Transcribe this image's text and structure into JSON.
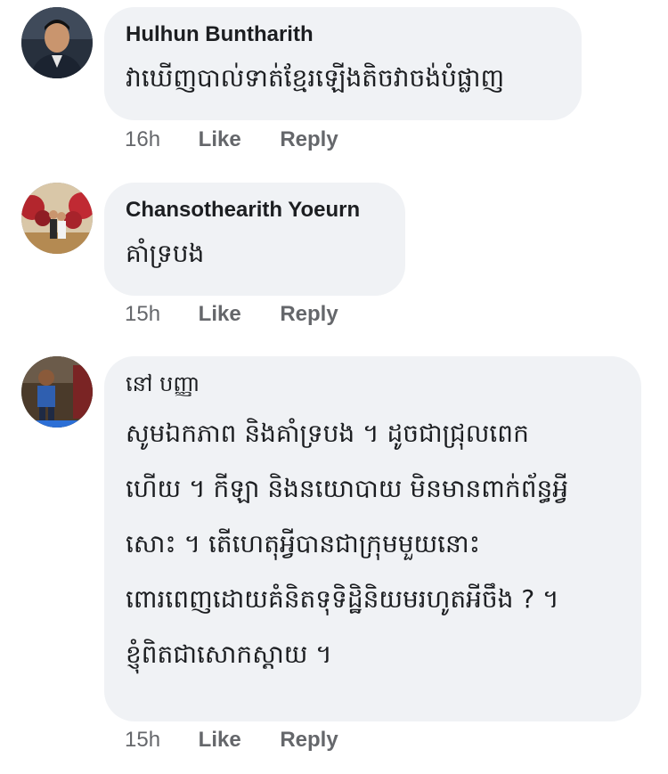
{
  "comments": [
    {
      "author": "Hulhun Buntharith",
      "text": "វាឃើញបាល់ទាត់ខ្មែរឡើងតិចវាចង់បំផ្លាញ",
      "time": "16h",
      "like_label": "Like",
      "reply_label": "Reply"
    },
    {
      "author": "Chansothearith Yoeurn",
      "text": "គាំទ្របង",
      "time": "15h",
      "like_label": "Like",
      "reply_label": "Reply"
    },
    {
      "author": "នៅ បញ្ញា",
      "lines": [
        "សូមឯកភាព និងគាំទ្របង ។ ដូចជាជ្រុលពេក",
        "ហើយ ។ កីឡា និងនយោបាយ មិនមានពាក់ព័ន្ធអ្វី",
        "សោះ ។ តើហេតុអ្វីបានជាក្រុមមួយនោះ",
        "ពោរពេញដោយគំនិតទុទិដ្ឋិនិយមរហូតអីចឹង ? ។",
        "ខ្ញុំពិតជាសោកស្ដាយ ។"
      ],
      "time": "15h",
      "like_label": "Like",
      "reply_label": "Reply"
    }
  ],
  "icons": {
    "avatar_1": "avatar-photo-man",
    "avatar_2": "avatar-photo-couple-flowers",
    "avatar_3": "avatar-photo-child"
  },
  "colors": {
    "bubble": "#f0f2f5",
    "text": "#1c1e21",
    "meta": "#65676b"
  }
}
